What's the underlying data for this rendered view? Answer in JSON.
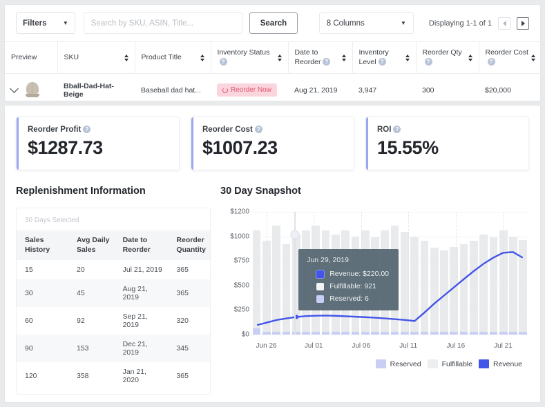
{
  "toolbar": {
    "filters_label": "Filters",
    "search_placeholder": "Search by SKU, ASIN, Title...",
    "search_value": "",
    "search_button": "Search",
    "columns_label": "8 Columns",
    "displaying": "Displaying 1-1 of 1"
  },
  "table": {
    "headers": [
      {
        "label": "Preview",
        "help": false,
        "sort": false
      },
      {
        "label": "SKU",
        "help": false,
        "sort": true
      },
      {
        "label": "Product Title",
        "help": false,
        "sort": true
      },
      {
        "label": "Inventory Status",
        "help": true,
        "sort": true
      },
      {
        "label": "Date to Reorder",
        "help": true,
        "sort": true
      },
      {
        "label": "Inventory Level",
        "help": true,
        "sort": true
      },
      {
        "label": "Reorder Qty",
        "help": true,
        "sort": true
      },
      {
        "label": "Reorder Cost",
        "help": true,
        "sort": true
      }
    ],
    "rows": [
      {
        "sku": "Bball-Dad-Hat-Beige",
        "product_title": "Baseball dad hat...",
        "inventory_status": "Reorder Now",
        "date_to_reorder": "Aug 21, 2019",
        "inventory_level": "3,947",
        "reorder_qty": "300",
        "reorder_cost": "$20,000"
      }
    ]
  },
  "kpis": [
    {
      "label": "Reorder Profit",
      "value": "$1287.73"
    },
    {
      "label": "Reorder Cost",
      "value": "$1007.23"
    },
    {
      "label": "ROI",
      "value": "15.55%"
    }
  ],
  "replenishment": {
    "title": "Replenishment Information",
    "note": "30 Days Selected",
    "headers": [
      "Sales History",
      "Avg Daily Sales",
      "Date to Reorder",
      "Reorder Quantity"
    ],
    "rows": [
      [
        "15",
        "20",
        "Jul 21, 2019",
        "365"
      ],
      [
        "30",
        "45",
        "Aug 21, 2019",
        "365"
      ],
      [
        "60",
        "92",
        "Sep 21, 2019",
        "320"
      ],
      [
        "90",
        "153",
        "Dec 21, 2019",
        "345"
      ],
      [
        "120",
        "358",
        "Jan 21, 2020",
        "365"
      ]
    ]
  },
  "snapshot": {
    "title": "30 Day Snapshot",
    "tooltip": {
      "date": "Jun 29, 2019",
      "rows": [
        {
          "label": "Revenue: $220.00",
          "color": "#4355e8"
        },
        {
          "label": "Fulfillable: 921",
          "color": "#f2f4f6"
        },
        {
          "label": "Reserved: 6",
          "color": "#c9cef4"
        }
      ]
    },
    "legend": [
      {
        "label": "Reserved",
        "color": "#c9cef4"
      },
      {
        "label": "Fulfillable",
        "color": "#eceef0"
      },
      {
        "label": "Revenue",
        "color": "#4355e8"
      }
    ]
  },
  "chart_data": {
    "type": "bar",
    "title": "30 Day Snapshot",
    "xlabel": "",
    "ylabel": "",
    "grid": true,
    "legend_position": "bottom-right",
    "ytick_labels": [
      "$1200",
      "$1000",
      "$750",
      "$500",
      "$250",
      "$0"
    ],
    "ytick_values": [
      1200,
      1000,
      750,
      500,
      250,
      0
    ],
    "ylim": [
      0,
      1200
    ],
    "xtick_labels": [
      "Jun 26",
      "Jul 01",
      "Jul 06",
      "Jul 11",
      "Jul 16",
      "Jul 21"
    ],
    "xtick_indices": [
      1,
      6,
      11,
      16,
      21,
      26
    ],
    "x": [
      "Jun 25",
      "Jun 26",
      "Jun 27",
      "Jun 28",
      "Jun 29",
      "Jun 30",
      "Jul 01",
      "Jul 02",
      "Jul 03",
      "Jul 04",
      "Jul 05",
      "Jul 06",
      "Jul 07",
      "Jul 08",
      "Jul 09",
      "Jul 10",
      "Jul 11",
      "Jul 12",
      "Jul 13",
      "Jul 14",
      "Jul 15",
      "Jul 16",
      "Jul 17",
      "Jul 18",
      "Jul 19",
      "Jul 20",
      "Jul 21",
      "Jul 22"
    ],
    "series": [
      {
        "name": "Fulfillable",
        "type": "bar",
        "color": "#e8eaec",
        "values": [
          1050,
          952,
          1090,
          921,
          1015,
          1050,
          1085,
          1050,
          1015,
          1050,
          995,
          1050,
          990,
          1050,
          1090,
          1035,
          995,
          955,
          888,
          855,
          890,
          920,
          955,
          1015,
          990,
          1050,
          1000,
          960
        ]
      },
      {
        "name": "Reserved",
        "type": "bar",
        "color": "#c9cef4",
        "values": [
          62,
          22,
          20,
          6,
          28,
          28,
          18,
          18,
          18,
          20,
          22,
          22,
          20,
          20,
          18,
          18,
          18,
          18,
          22,
          22,
          22,
          22,
          20,
          18,
          18,
          18,
          18,
          18
        ]
      },
      {
        "name": "Revenue",
        "type": "line",
        "color": "#4355e8",
        "values": [
          140,
          165,
          190,
          205,
          220,
          228,
          232,
          233,
          230,
          226,
          222,
          218,
          212,
          205,
          198,
          190,
          180,
          262,
          350,
          430,
          510,
          590,
          668,
          740,
          800,
          848,
          855,
          800
        ]
      }
    ]
  }
}
